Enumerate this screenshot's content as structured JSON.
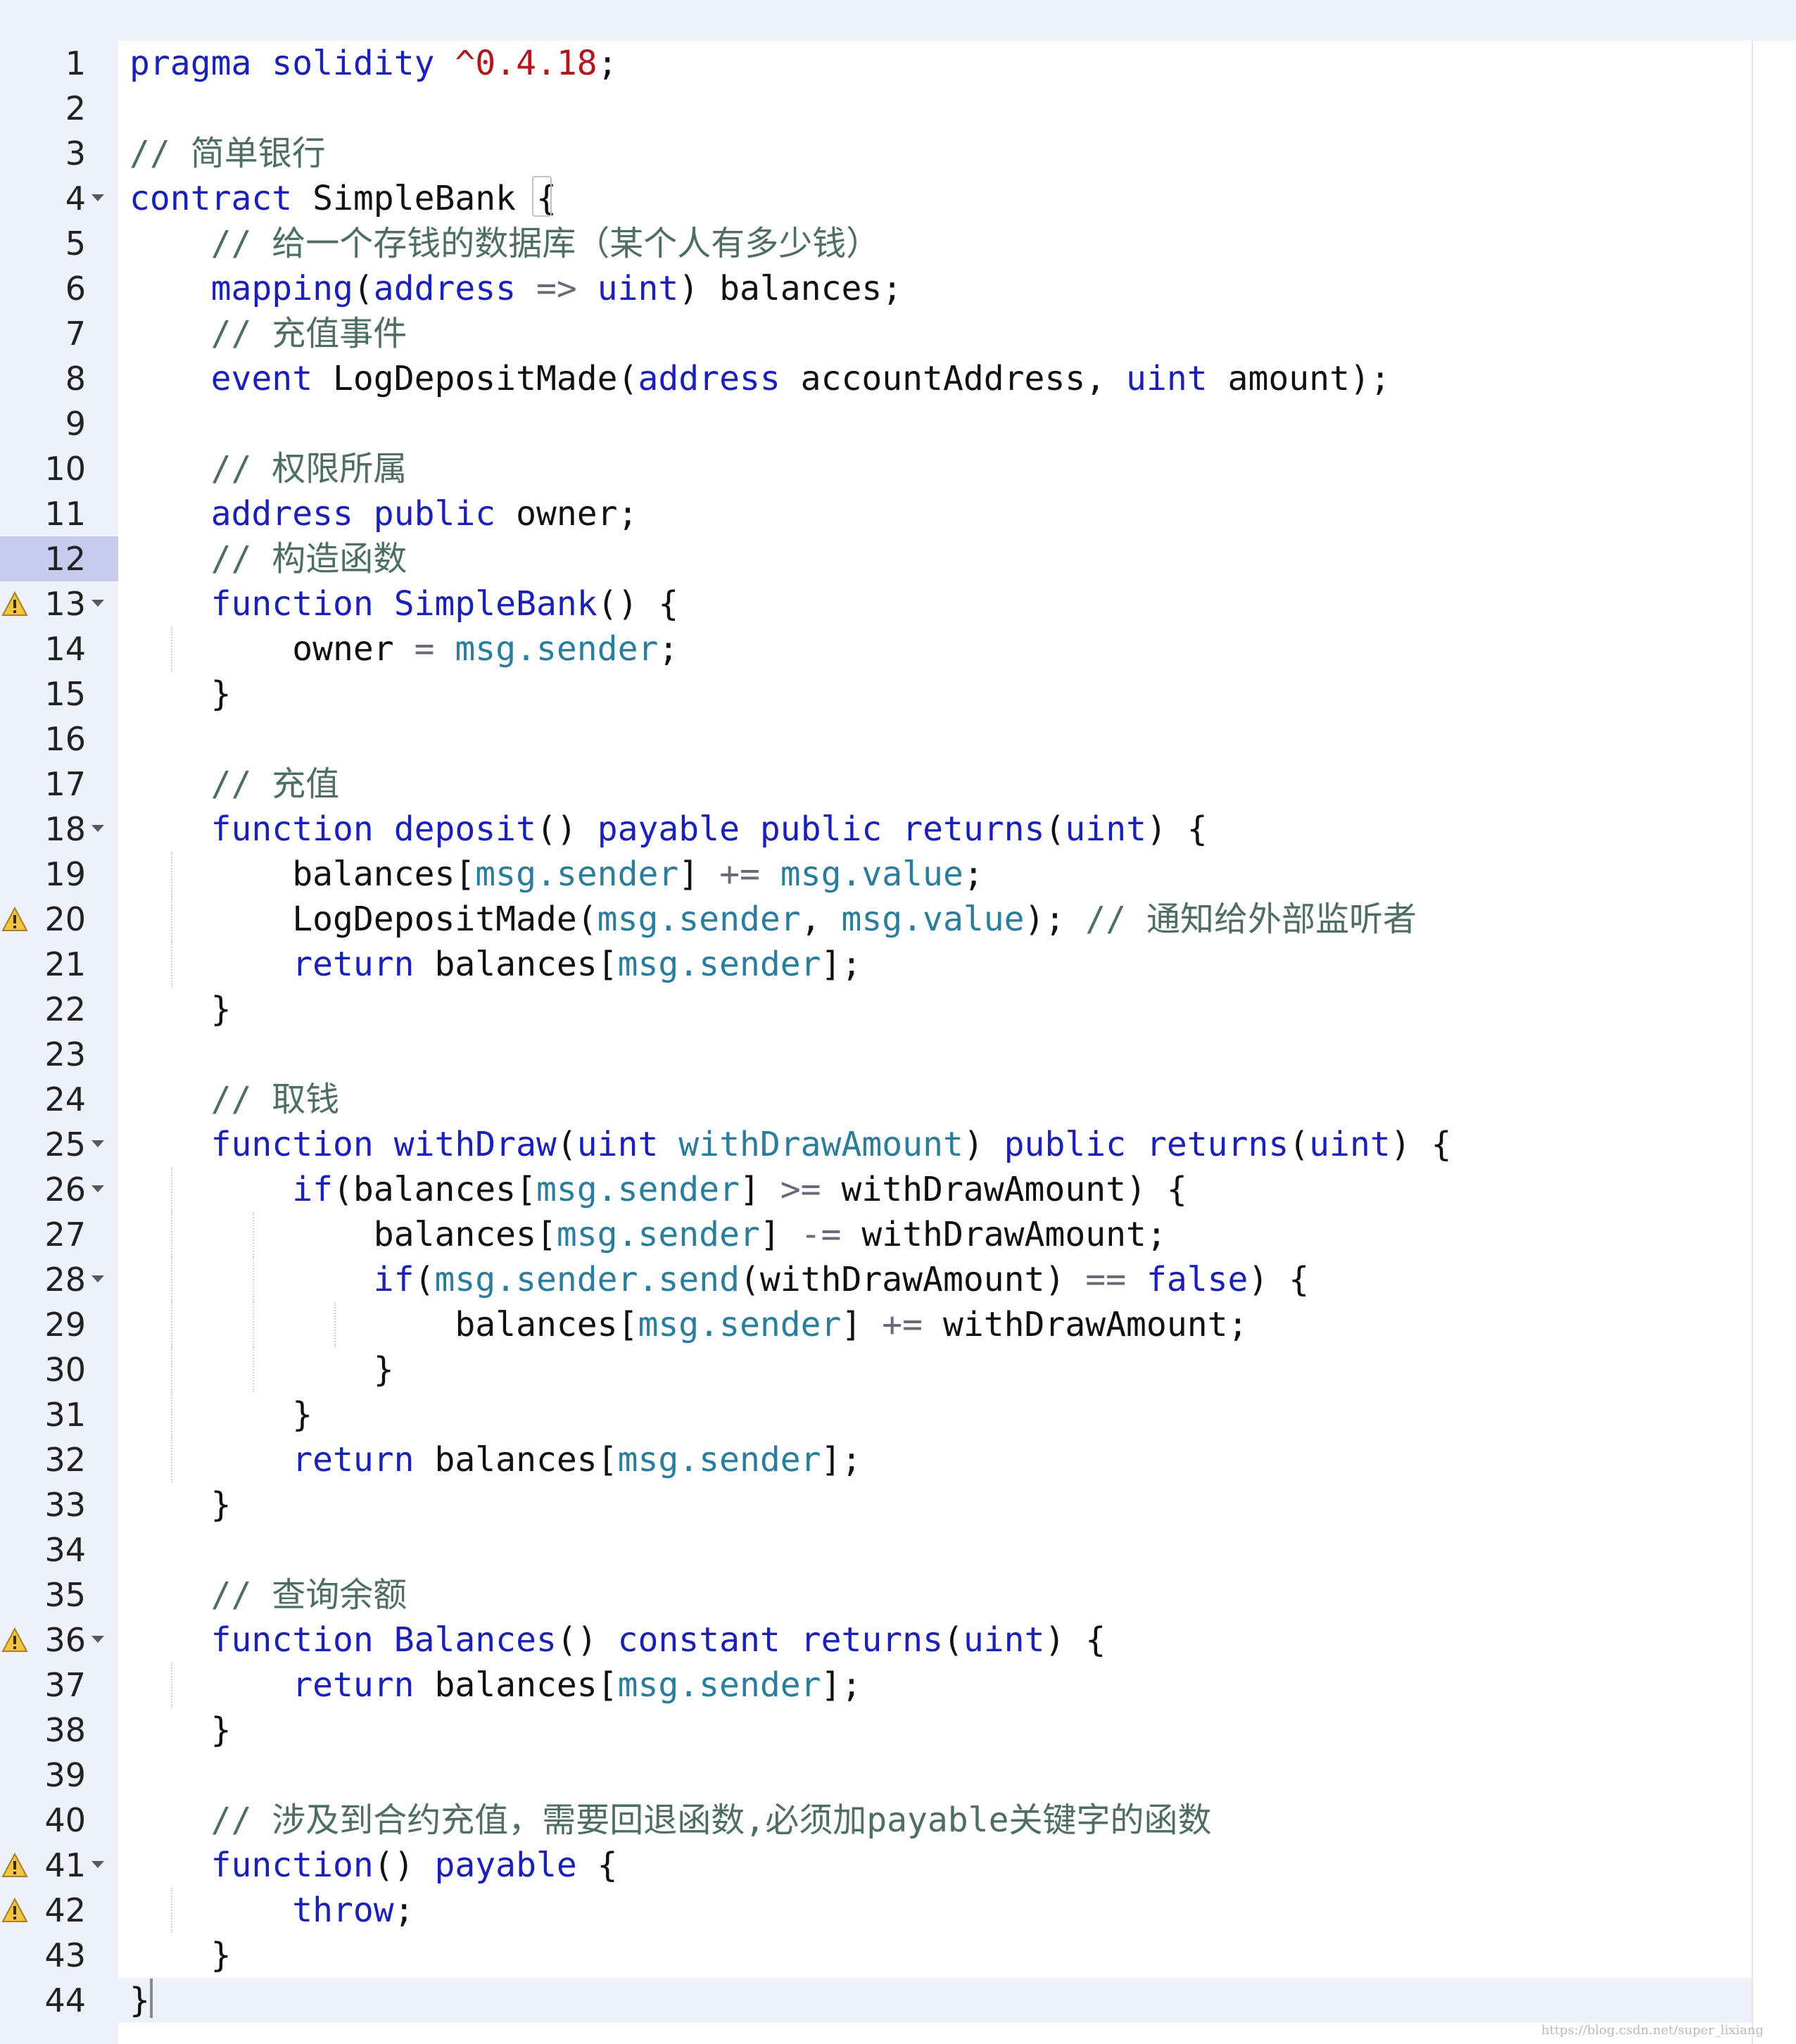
{
  "editor": {
    "language": "solidity",
    "active_line": 12,
    "colors": {
      "keyword": "#1b20b8",
      "string": "#b3161b",
      "comment": "#4e6e62",
      "builtin": "#2a7d9c",
      "operator": "#6a6a7a",
      "identifier": "#111111",
      "gutter_bg": "#eef0fa",
      "active_line_bg": "#c7cbed"
    },
    "lines": [
      {
        "n": "1",
        "tokens": [
          [
            "kw",
            "pragma"
          ],
          [
            "id",
            " "
          ],
          [
            "kw",
            "solidity"
          ],
          [
            "id",
            " "
          ],
          [
            "str",
            "^0.4.18"
          ],
          [
            "id",
            ";"
          ]
        ]
      },
      {
        "n": "2",
        "tokens": []
      },
      {
        "n": "3",
        "tokens": [
          [
            "cm",
            "// 简单银行"
          ]
        ]
      },
      {
        "n": "4",
        "fold": true,
        "tokens": [
          [
            "kw",
            "contract"
          ],
          [
            "id",
            " SimpleBank "
          ],
          [
            "id",
            "{"
          ]
        ]
      },
      {
        "n": "5",
        "tokens": [
          [
            "id",
            "    "
          ],
          [
            "cm",
            "// 给一个存钱的数据库（某个人有多少钱）"
          ]
        ]
      },
      {
        "n": "6",
        "tokens": [
          [
            "id",
            "    "
          ],
          [
            "kw",
            "mapping"
          ],
          [
            "id",
            "("
          ],
          [
            "kw",
            "address"
          ],
          [
            "id",
            " "
          ],
          [
            "op",
            "=>"
          ],
          [
            "id",
            " "
          ],
          [
            "kw",
            "uint"
          ],
          [
            "id",
            ") balances;"
          ]
        ]
      },
      {
        "n": "7",
        "tokens": [
          [
            "id",
            "    "
          ],
          [
            "cm",
            "// 充值事件"
          ]
        ]
      },
      {
        "n": "8",
        "tokens": [
          [
            "id",
            "    "
          ],
          [
            "kw",
            "event"
          ],
          [
            "id",
            " LogDepositMade("
          ],
          [
            "kw",
            "address"
          ],
          [
            "id",
            " accountAddress, "
          ],
          [
            "kw",
            "uint"
          ],
          [
            "id",
            " amount);"
          ]
        ]
      },
      {
        "n": "9",
        "tokens": []
      },
      {
        "n": "10",
        "tokens": [
          [
            "id",
            "    "
          ],
          [
            "cm",
            "// 权限所属"
          ]
        ]
      },
      {
        "n": "11",
        "tokens": [
          [
            "id",
            "    "
          ],
          [
            "kw",
            "address"
          ],
          [
            "id",
            " "
          ],
          [
            "kw",
            "public"
          ],
          [
            "id",
            " owner;"
          ]
        ]
      },
      {
        "n": "12",
        "tokens": [
          [
            "id",
            "    "
          ],
          [
            "cm",
            "// 构造函数"
          ]
        ]
      },
      {
        "n": "13",
        "warn": true,
        "fold": true,
        "tokens": [
          [
            "id",
            "    "
          ],
          [
            "kw",
            "function"
          ],
          [
            "id",
            " "
          ],
          [
            "kw",
            "SimpleBank"
          ],
          [
            "id",
            "() {"
          ]
        ]
      },
      {
        "n": "14",
        "guides": [
          1
        ],
        "tokens": [
          [
            "id",
            "        owner "
          ],
          [
            "op",
            "="
          ],
          [
            "id",
            " "
          ],
          [
            "msg",
            "msg.sender"
          ],
          [
            "id",
            ";"
          ]
        ]
      },
      {
        "n": "15",
        "tokens": [
          [
            "id",
            "    }"
          ]
        ]
      },
      {
        "n": "16",
        "tokens": []
      },
      {
        "n": "17",
        "tokens": [
          [
            "id",
            "    "
          ],
          [
            "cm",
            "// 充值"
          ]
        ]
      },
      {
        "n": "18",
        "fold": true,
        "tokens": [
          [
            "id",
            "    "
          ],
          [
            "kw",
            "function"
          ],
          [
            "id",
            " "
          ],
          [
            "kw",
            "deposit"
          ],
          [
            "id",
            "() "
          ],
          [
            "kw",
            "payable"
          ],
          [
            "id",
            " "
          ],
          [
            "kw",
            "public"
          ],
          [
            "id",
            " "
          ],
          [
            "kw",
            "returns"
          ],
          [
            "id",
            "("
          ],
          [
            "kw",
            "uint"
          ],
          [
            "id",
            ") {"
          ]
        ]
      },
      {
        "n": "19",
        "guides": [
          1
        ],
        "tokens": [
          [
            "id",
            "        balances["
          ],
          [
            "msg",
            "msg.sender"
          ],
          [
            "id",
            "] "
          ],
          [
            "op",
            "+="
          ],
          [
            "id",
            " "
          ],
          [
            "msg",
            "msg.value"
          ],
          [
            "id",
            ";"
          ]
        ]
      },
      {
        "n": "20",
        "warn": true,
        "guides": [
          1
        ],
        "tokens": [
          [
            "id",
            "        LogDepositMade("
          ],
          [
            "msg",
            "msg.sender"
          ],
          [
            "id",
            ", "
          ],
          [
            "msg",
            "msg.value"
          ],
          [
            "id",
            "); "
          ],
          [
            "cm",
            "// 通知给外部监听者"
          ]
        ]
      },
      {
        "n": "21",
        "guides": [
          1
        ],
        "tokens": [
          [
            "id",
            "        "
          ],
          [
            "kw",
            "return"
          ],
          [
            "id",
            " balances["
          ],
          [
            "msg",
            "msg.sender"
          ],
          [
            "id",
            "];"
          ]
        ]
      },
      {
        "n": "22",
        "tokens": [
          [
            "id",
            "    }"
          ]
        ]
      },
      {
        "n": "23",
        "tokens": []
      },
      {
        "n": "24",
        "tokens": [
          [
            "id",
            "    "
          ],
          [
            "cm",
            "// 取钱"
          ]
        ]
      },
      {
        "n": "25",
        "fold": true,
        "tokens": [
          [
            "id",
            "    "
          ],
          [
            "kw",
            "function"
          ],
          [
            "id",
            " "
          ],
          [
            "kw",
            "withDraw"
          ],
          [
            "id",
            "("
          ],
          [
            "kw",
            "uint"
          ],
          [
            "id",
            " "
          ],
          [
            "msg",
            "withDrawAmount"
          ],
          [
            "id",
            ") "
          ],
          [
            "kw",
            "public"
          ],
          [
            "id",
            " "
          ],
          [
            "kw",
            "returns"
          ],
          [
            "id",
            "("
          ],
          [
            "kw",
            "uint"
          ],
          [
            "id",
            ") {"
          ]
        ]
      },
      {
        "n": "26",
        "fold": true,
        "guides": [
          1
        ],
        "tokens": [
          [
            "id",
            "        "
          ],
          [
            "kw",
            "if"
          ],
          [
            "id",
            "(balances["
          ],
          [
            "msg",
            "msg.sender"
          ],
          [
            "id",
            "] "
          ],
          [
            "op",
            ">="
          ],
          [
            "id",
            " withDrawAmount) {"
          ]
        ]
      },
      {
        "n": "27",
        "guides": [
          1,
          2
        ],
        "tokens": [
          [
            "id",
            "            balances["
          ],
          [
            "msg",
            "msg.sender"
          ],
          [
            "id",
            "] "
          ],
          [
            "op",
            "-="
          ],
          [
            "id",
            " withDrawAmount;"
          ]
        ]
      },
      {
        "n": "28",
        "fold": true,
        "guides": [
          1,
          2
        ],
        "tokens": [
          [
            "id",
            "            "
          ],
          [
            "kw",
            "if"
          ],
          [
            "id",
            "("
          ],
          [
            "msg",
            "msg.sender.send"
          ],
          [
            "id",
            "(withDrawAmount) "
          ],
          [
            "op",
            "=="
          ],
          [
            "id",
            " "
          ],
          [
            "kw",
            "false"
          ],
          [
            "id",
            ") {"
          ]
        ]
      },
      {
        "n": "29",
        "guides": [
          1,
          2,
          3
        ],
        "tokens": [
          [
            "id",
            "                balances["
          ],
          [
            "msg",
            "msg.sender"
          ],
          [
            "id",
            "] "
          ],
          [
            "op",
            "+="
          ],
          [
            "id",
            " withDrawAmount;"
          ]
        ]
      },
      {
        "n": "30",
        "guides": [
          1,
          2
        ],
        "tokens": [
          [
            "id",
            "            }"
          ]
        ]
      },
      {
        "n": "31",
        "guides": [
          1
        ],
        "tokens": [
          [
            "id",
            "        }"
          ]
        ]
      },
      {
        "n": "32",
        "guides": [
          1
        ],
        "tokens": [
          [
            "id",
            "        "
          ],
          [
            "kw",
            "return"
          ],
          [
            "id",
            " balances["
          ],
          [
            "msg",
            "msg.sender"
          ],
          [
            "id",
            "];"
          ]
        ]
      },
      {
        "n": "33",
        "tokens": [
          [
            "id",
            "    }"
          ]
        ]
      },
      {
        "n": "34",
        "tokens": []
      },
      {
        "n": "35",
        "tokens": [
          [
            "id",
            "    "
          ],
          [
            "cm",
            "// 查询余额"
          ]
        ]
      },
      {
        "n": "36",
        "warn": true,
        "fold": true,
        "tokens": [
          [
            "id",
            "    "
          ],
          [
            "kw",
            "function"
          ],
          [
            "id",
            " "
          ],
          [
            "kw",
            "Balances"
          ],
          [
            "id",
            "() "
          ],
          [
            "kw",
            "constant"
          ],
          [
            "id",
            " "
          ],
          [
            "kw",
            "returns"
          ],
          [
            "id",
            "("
          ],
          [
            "kw",
            "uint"
          ],
          [
            "id",
            ") {"
          ]
        ]
      },
      {
        "n": "37",
        "guides": [
          1
        ],
        "tokens": [
          [
            "id",
            "        "
          ],
          [
            "kw",
            "return"
          ],
          [
            "id",
            " balances["
          ],
          [
            "msg",
            "msg.sender"
          ],
          [
            "id",
            "];"
          ]
        ]
      },
      {
        "n": "38",
        "tokens": [
          [
            "id",
            "    }"
          ]
        ]
      },
      {
        "n": "39",
        "tokens": []
      },
      {
        "n": "40",
        "tokens": [
          [
            "id",
            "    "
          ],
          [
            "cm",
            "// 涉及到合约充值，需要回退函数,必须加payable关键字的函数"
          ]
        ]
      },
      {
        "n": "41",
        "warn": true,
        "fold": true,
        "tokens": [
          [
            "id",
            "    "
          ],
          [
            "kw",
            "function"
          ],
          [
            "id",
            "() "
          ],
          [
            "kw",
            "payable"
          ],
          [
            "id",
            " {"
          ]
        ]
      },
      {
        "n": "42",
        "warn": true,
        "guides": [
          1
        ],
        "tokens": [
          [
            "id",
            "        "
          ],
          [
            "kw",
            "throw"
          ],
          [
            "id",
            ";"
          ]
        ]
      },
      {
        "n": "43",
        "tokens": [
          [
            "id",
            "    }"
          ]
        ]
      },
      {
        "n": "44",
        "tokens": [
          [
            "id",
            "}"
          ]
        ]
      }
    ]
  },
  "icons": {
    "warning": "warning-triangle-icon",
    "fold": "fold-arrow-icon"
  },
  "watermark": "https://blog.csdn.net/super_lixiang"
}
